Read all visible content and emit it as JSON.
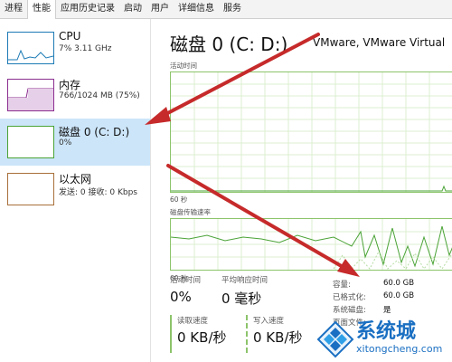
{
  "tabs": [
    "进程",
    "性能",
    "应用历史记录",
    "启动",
    "用户",
    "详细信息",
    "服务"
  ],
  "sidebar": {
    "items": [
      {
        "title": "CPU",
        "sub": "7%  3.11 GHz",
        "color": "#1b7ab5"
      },
      {
        "title": "内存",
        "sub": "766/1024 MB (75%)",
        "color": "#8b2d8f"
      },
      {
        "title": "磁盘 0 (C: D:)",
        "sub": "0%",
        "color": "#4aa336"
      },
      {
        "title": "以太网",
        "sub": "发送: 0  接收: 0 Kbps",
        "color": "#a86f3a"
      }
    ]
  },
  "main": {
    "title": "磁盘 0 (C: D:)",
    "model": "VMware, VMware Virtual",
    "graph1_label": "活动时间",
    "graph1_axis": "60 秒",
    "graph2_label": "磁盘传输速率",
    "graph2_axis": "60 秒",
    "active_time_label": "活动时间",
    "active_time_value": "0%",
    "avg_response_label": "平均响应时间",
    "avg_response_value": "0 毫秒",
    "read_label": "读取速度",
    "read_value": "0 KB/秒",
    "write_label": "写入速度",
    "write_value": "0 KB/秒",
    "details": [
      {
        "label": "容量:",
        "value": "60.0 GB"
      },
      {
        "label": "已格式化:",
        "value": "60.0 GB"
      },
      {
        "label": "系统磁盘:",
        "value": "是"
      },
      {
        "label": "页面文件:",
        "value": ""
      }
    ]
  },
  "watermark": {
    "text": "系统城",
    "url": "xitongcheng.com"
  },
  "colors": {
    "accent_green": "#8cc46b",
    "arrow": "#c62a2a",
    "selection": "#cce5f9"
  }
}
